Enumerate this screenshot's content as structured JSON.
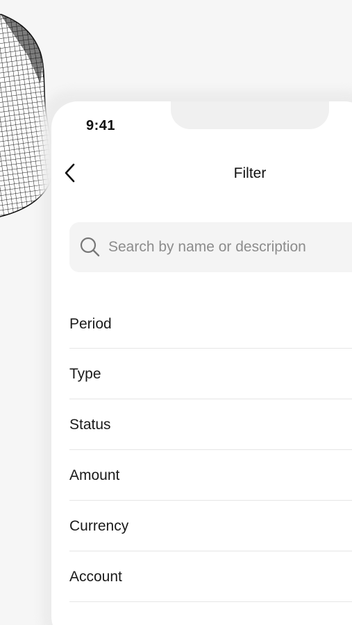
{
  "status_bar": {
    "time": "9:41"
  },
  "header": {
    "title": "Filter",
    "back_icon": "chevron-left-icon"
  },
  "search": {
    "placeholder": "Search by name or description",
    "value": "",
    "icon": "search-icon"
  },
  "filters": [
    {
      "label": "Period"
    },
    {
      "label": "Type"
    },
    {
      "label": "Status"
    },
    {
      "label": "Amount"
    },
    {
      "label": "Currency"
    },
    {
      "label": "Account"
    }
  ],
  "colors": {
    "background": "#f6f6f6",
    "surface": "#ffffff",
    "search_bg": "#f4f4f4",
    "divider": "#e6e6e6",
    "text": "#1a1a1a",
    "placeholder": "#8c8c8c"
  }
}
